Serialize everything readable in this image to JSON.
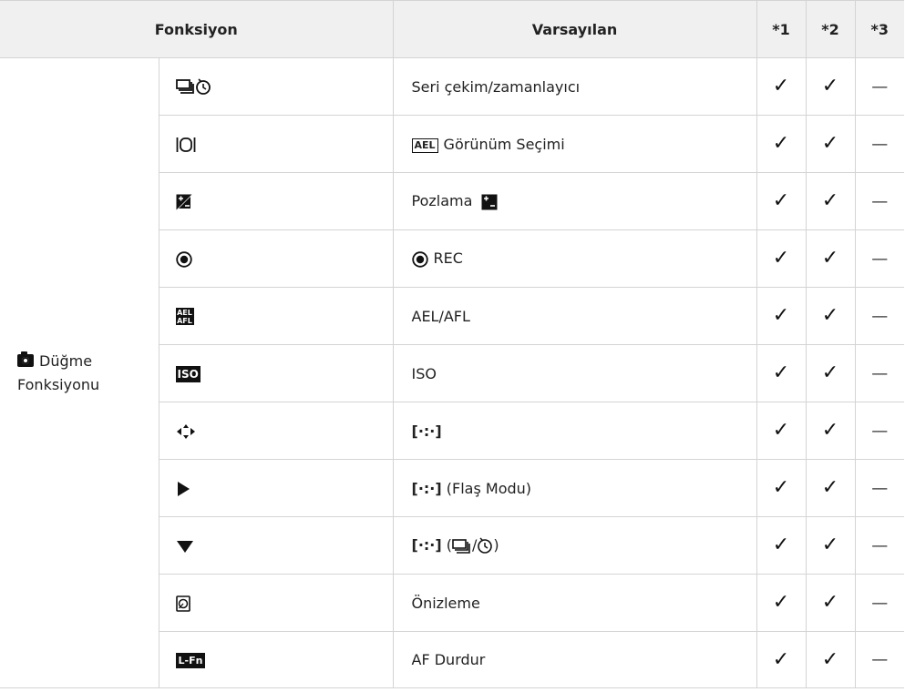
{
  "header": {
    "col_func": "Fonksiyon",
    "col_default": "Varsayılan",
    "col1": "*1",
    "col2": "*2",
    "col3": "*3"
  },
  "group": {
    "line1": "Düğme",
    "line2": "Fonksiyonu"
  },
  "glyphs": {
    "check": "✓",
    "dash": "—"
  },
  "rows": [
    {
      "icon": "sequential-self-timer-icon",
      "default": "Seri çekim/zamanlayıcı"
    },
    {
      "icon": "view-selection-icon",
      "default_badge": "AEL",
      "default": "Görünüm Seçimi"
    },
    {
      "icon": "exposure-comp-icon",
      "default": "Pozlama"
    },
    {
      "icon": "record-icon",
      "default": "REC"
    },
    {
      "icon": "ael-afl-icon",
      "icon_text_top": "AEL",
      "icon_text_bottom": "AFL",
      "default": "AEL/AFL"
    },
    {
      "icon": "iso-icon",
      "icon_text": "ISO",
      "default": "ISO"
    },
    {
      "icon": "arrows-lr-icon",
      "default_bracket": "[·:·]"
    },
    {
      "icon": "triangle-right-icon",
      "default_bracket": "[·:·]",
      "default": "(Flaş Modu)"
    },
    {
      "icon": "triangle-down-icon",
      "default_bracket": "[·:·]",
      "default_paren_open": "(",
      "default_slash": "/",
      "default_paren_close": ")"
    },
    {
      "icon": "preview-icon",
      "default": "Önizleme"
    },
    {
      "icon": "lfn-icon",
      "icon_text": "L-Fn",
      "default": "AF Durdur"
    }
  ]
}
